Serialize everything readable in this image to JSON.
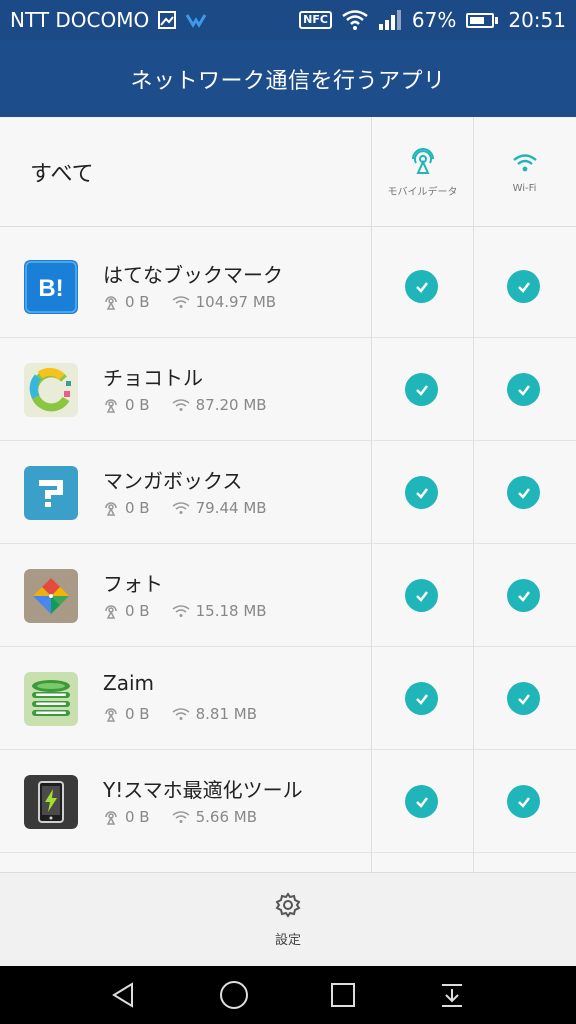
{
  "status_bar": {
    "carrier": "NTT DOCOMO",
    "nfc_label": "NFC",
    "battery_percent": "67%",
    "battery_level": 0.67,
    "time": "20:51"
  },
  "title": "ネットワーク通信を行うアプリ",
  "header": {
    "all_label": "すべて",
    "mobile_data_label": "モバイルデータ",
    "wifi_label": "Wi-Fi"
  },
  "apps": [
    {
      "name": "はてなブックマーク",
      "mobile": "0 B",
      "wifi": "104.97 MB",
      "icon": "hatena-bookmark-icon",
      "mobile_on": true,
      "wifi_on": true
    },
    {
      "name": "チョコトル",
      "mobile": "0 B",
      "wifi": "87.20 MB",
      "icon": "chocotoru-icon",
      "mobile_on": true,
      "wifi_on": true
    },
    {
      "name": "マンガボックス",
      "mobile": "0 B",
      "wifi": "79.44 MB",
      "icon": "manga-box-icon",
      "mobile_on": true,
      "wifi_on": true
    },
    {
      "name": "フォト",
      "mobile": "0 B",
      "wifi": "15.18 MB",
      "icon": "photos-icon",
      "mobile_on": true,
      "wifi_on": true
    },
    {
      "name": "Zaim",
      "mobile": "0 B",
      "wifi": "8.81 MB",
      "icon": "zaim-icon",
      "mobile_on": true,
      "wifi_on": true
    },
    {
      "name": "Y!スマホ最適化ツール",
      "mobile": "0 B",
      "wifi": "5.66 MB",
      "icon": "yahoo-optimizer-icon",
      "mobile_on": true,
      "wifi_on": true
    }
  ],
  "bottom": {
    "settings_label": "設定"
  },
  "colors": {
    "header_blue": "#1e4d8b",
    "check_teal": "#1fb5b9"
  }
}
